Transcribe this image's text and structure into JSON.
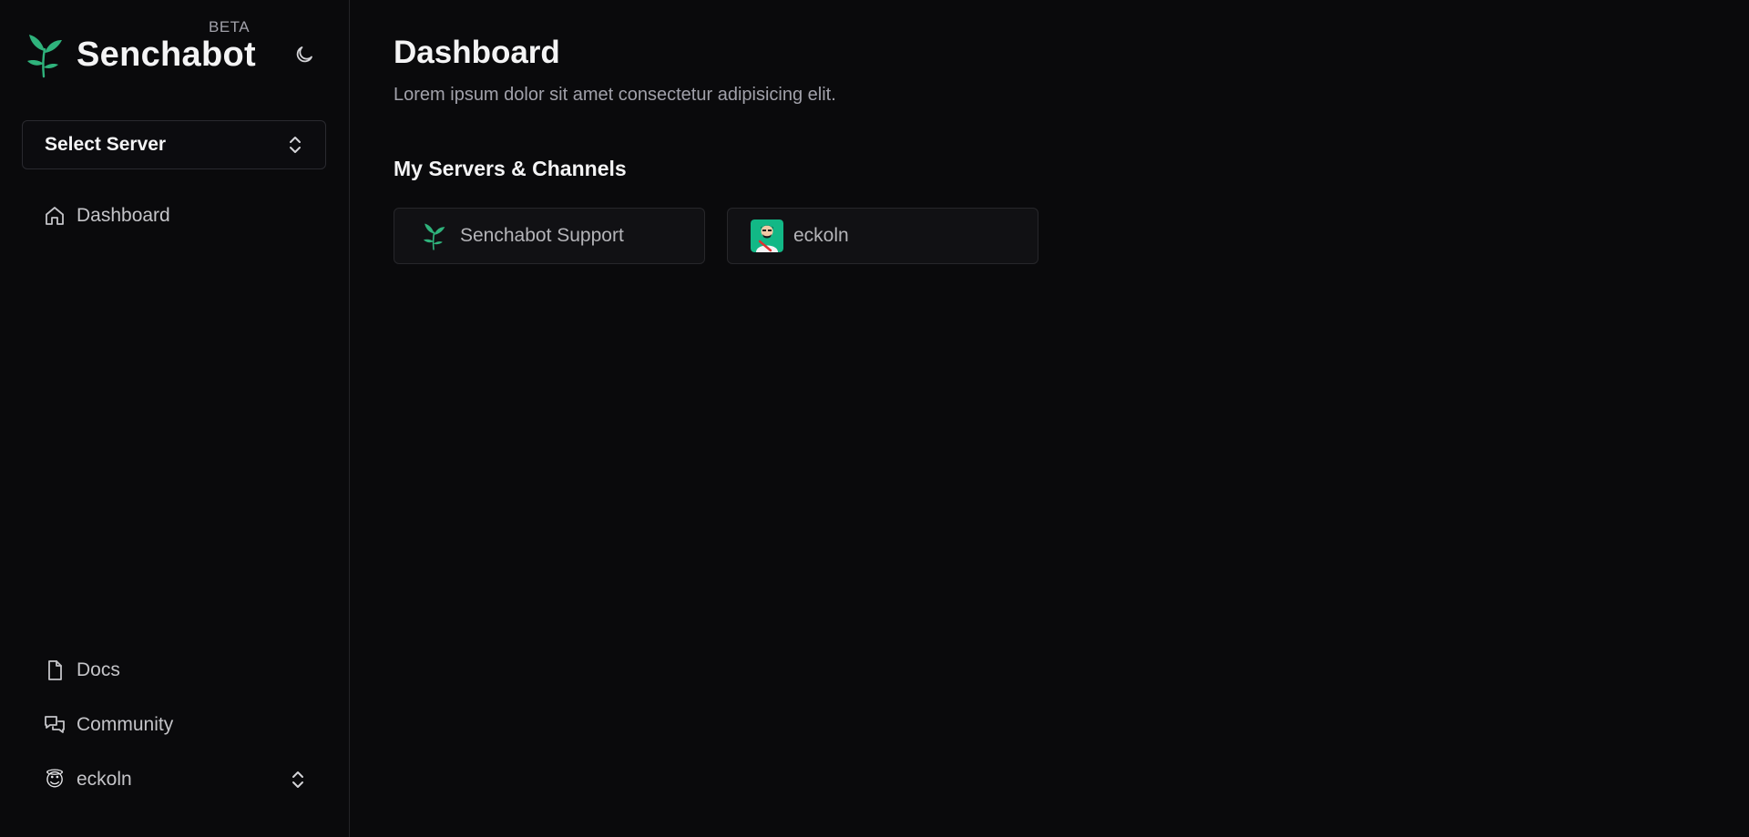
{
  "brand": {
    "name": "Senchabot",
    "badge": "BETA",
    "accent_color": "#2fb37c"
  },
  "sidebar": {
    "server_select": {
      "label": "Select Server"
    },
    "nav": [
      {
        "label": "Dashboard",
        "icon": "home-icon"
      }
    ],
    "footer_links": [
      {
        "label": "Docs",
        "icon": "file-icon"
      },
      {
        "label": "Community",
        "icon": "chat-icon"
      }
    ],
    "user": {
      "emoji": "😇",
      "name": "eckoln"
    }
  },
  "main": {
    "title": "Dashboard",
    "subtitle": "Lorem ipsum dolor sit amet consectetur adipisicing elit.",
    "section_title": "My Servers & Channels",
    "cards": [
      {
        "label": "Senchabot Support",
        "icon": "sprout-logo-icon"
      },
      {
        "label": "eckoln",
        "icon": "user-avatar"
      }
    ]
  }
}
